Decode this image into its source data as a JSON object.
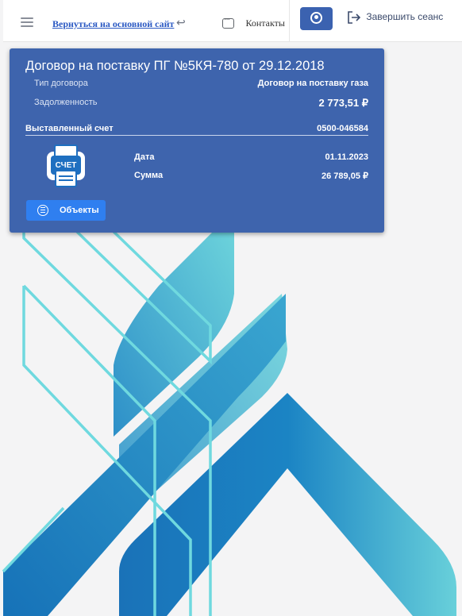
{
  "topbar": {
    "back_link": "Вернуться на основной сайт",
    "contacts_label": "Контакты",
    "logout_label": "Завершить сеанс",
    "icons": [
      "menu-icon",
      "back-arrow-icon",
      "chat-icon",
      "user-icon",
      "logout-icon"
    ]
  },
  "contract": {
    "title": "Договор на поставку ПГ №5КЯ-780 от 29.12.2018",
    "type_label": "Тип договора",
    "type_value": "Договор на поставку газа",
    "debt_label": "Задолженность",
    "debt_value": "2 773,51 ₽"
  },
  "invoice": {
    "label": "Выставленный счет",
    "number": "0500-046584",
    "icon_text": "СЧЕТ",
    "date_label": "Дата",
    "date_value": "01.11.2023",
    "sum_label": "Сумма",
    "sum_value": "26 789,05 ₽"
  },
  "buttons": {
    "objects_label": "Объекты"
  },
  "colors": {
    "card": "#3e64ad",
    "accent_button": "#2f7ff0",
    "user_button": "#3b62b0",
    "background_teal": "#6fd6dc",
    "background_blue": "#1a78bd"
  }
}
